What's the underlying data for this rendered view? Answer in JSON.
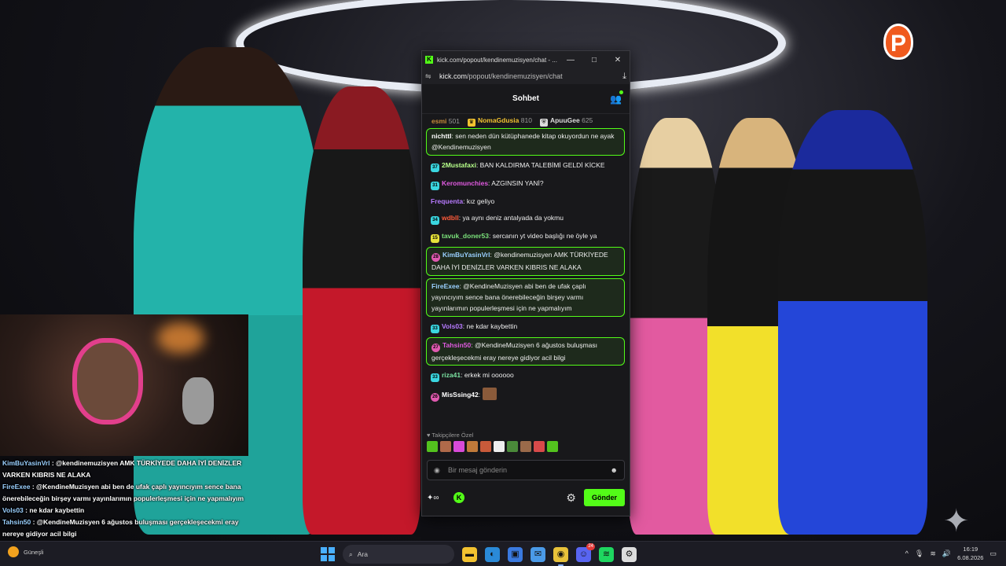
{
  "overlay_chat": [
    {
      "user": "KimBuYasinVrl",
      "text": " : @kendinemuzisyen AMK TÜRKİYEDE DAHA İYİ DENİZLER VARKEN KIBRIS NE ALAKA"
    },
    {
      "user": "FireExee",
      "text": " : @KendineMuzisyen abi ben de ufak çaplı yayıncıyım sence bana önerebileceğin birşey varmı yayınlarımın populerleşmesi için ne yapmalıyım"
    },
    {
      "user": "Vols03",
      "text": " : ne kdar kaybettin"
    },
    {
      "user": "Tahsin50",
      "text": " : @KendineMuzisyen 6 ağustos buluşması gerçekleşecekmi eray nereye gidiyor acil bilgi"
    },
    {
      "user": "riza41",
      "text": " : erkek mi oooooo"
    }
  ],
  "window": {
    "title": "kick.com/popout/kendinemuzisyen/chat - ...",
    "url_domain": "kick.com",
    "url_path": "/popout/kendinemuzisyen/chat",
    "favicon": "K"
  },
  "chat": {
    "header": "Sohbet",
    "leaders": [
      {
        "name": "esmi",
        "count": "501",
        "color": "#c88a3a",
        "icon": ""
      },
      {
        "name": "NomaGdusia",
        "count": "810",
        "color": "#f2c230",
        "icon": "crown-icon"
      },
      {
        "name": "ApuuGee",
        "count": "625",
        "color": "#dddddd",
        "icon": "shield-icon"
      }
    ],
    "messages": [
      {
        "badge": "",
        "user": "nichttl",
        "ucolor": "#ffffff",
        "text": ": sen neden dün kütüphanede kitap okuyordun ne ayak @Kendinemuzisyen",
        "hl": true,
        "bcolor": ""
      },
      {
        "badge": "37",
        "user": "2Mustafaxi",
        "ucolor": "#b7ff8a",
        "text": ": BAN KALDIRMA TALEBİMİ GELDİ KİCKE",
        "hl": false,
        "bcolor": "#3ad6e0"
      },
      {
        "badge": "31",
        "user": "Keromunchies",
        "ucolor": "#e05ae0",
        "text": ": AZGINSIN YANİ?",
        "hl": false,
        "bcolor": "#3ad6e0"
      },
      {
        "badge": "",
        "user": "Frequenta",
        "ucolor": "#b77aff",
        "text": ": kız geliyo",
        "hl": false,
        "bcolor": ""
      },
      {
        "badge": "34",
        "user": "wdbll",
        "ucolor": "#ff5a3a",
        "text": ": ya aynı deniz antalyada da yokmu",
        "hl": false,
        "bcolor": "#3ad6e0"
      },
      {
        "badge": "15",
        "user": "tavuk_doner53",
        "ucolor": "#7ae07a",
        "text": ": sercanın yt video başlığı ne öyle ya",
        "hl": false,
        "bcolor": "#e6e23a"
      },
      {
        "badge": "28",
        "user": "KimBuYasinVrl",
        "ucolor": "#9ad0ff",
        "text": ": @kendinemuzisyen AMK TÜRKİYEDE DAHA İYİ DENİZLER VARKEN KIBRIS NE ALAKA",
        "hl": true,
        "bcolor": "#e05ab0"
      },
      {
        "badge": "",
        "user": "FireExee",
        "ucolor": "#9ad0ff",
        "text": ": @KendineMuzisyen abi ben de ufak çaplı yayıncıyım sence bana önerebileceğin birşey varmı yayınlarımın populerleşmesi için ne yapmalıyım",
        "hl": true,
        "bcolor": ""
      },
      {
        "badge": "33",
        "user": "Vols03",
        "ucolor": "#b77aff",
        "text": ": ne kdar kaybettin",
        "hl": false,
        "bcolor": "#3ad6e0"
      },
      {
        "badge": "27",
        "user": "Tahsin50",
        "ucolor": "#e05ae0",
        "text": ": @KendineMuzisyen 6 ağustos buluşması gerçekleşecekmi eray nereye gidiyor acil bilgi",
        "hl": true,
        "bcolor": "#e05ab0"
      },
      {
        "badge": "33",
        "user": "riza41",
        "ucolor": "#7ae0a0",
        "text": ": erkek mi oooooo",
        "hl": false,
        "bcolor": "#3ad6e0"
      },
      {
        "badge": "26",
        "user": "MisSsing42",
        "ucolor": "#ffffff",
        "text": ":",
        "hl": false,
        "bcolor": "#e05ab0",
        "emote": true
      }
    ],
    "emote_label": "♥ Takipçilere Özel",
    "emote_colors": [
      "#53c21e",
      "#b06a4a",
      "#d84ad8",
      "#c07a3a",
      "#c85a3a",
      "#eeeeee",
      "#4a8a3a",
      "#9a6a4a",
      "#d84a4a",
      "#53c21e"
    ],
    "input_placeholder": "Bir mesaj gönderin",
    "send_label": "Gönder"
  },
  "taskbar": {
    "weather": "Güneşli",
    "search_label": "Ara",
    "time": "16:19",
    "date": "6.08.2026",
    "apps": [
      "file-explorer-icon",
      "edge-icon",
      "store-icon",
      "mail-icon",
      "chrome-icon",
      "discord-icon",
      "spotify-icon",
      "steam-icon"
    ],
    "app_colors": [
      "#f2c230",
      "#2a8ad8",
      "#3a7ae0",
      "#4a9ae8",
      "#e8c23a",
      "#5865f2",
      "#1ed760",
      "#dddddd"
    ],
    "discord_badge": "24"
  }
}
